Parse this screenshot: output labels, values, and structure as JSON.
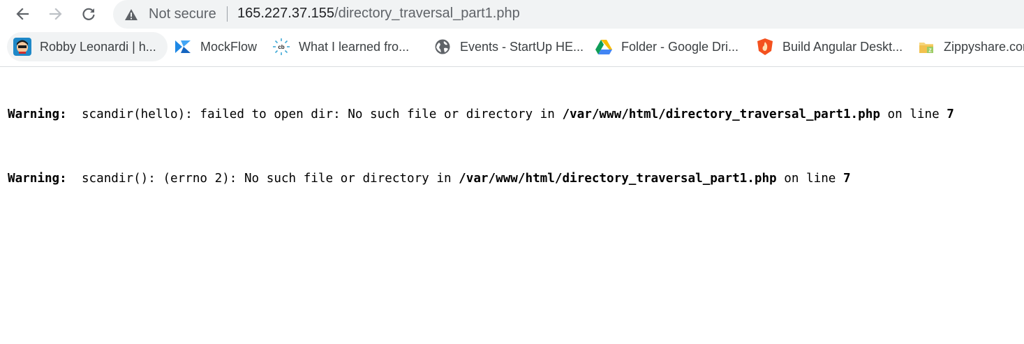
{
  "nav": {
    "back_icon": "back-arrow-icon",
    "forward_icon": "forward-arrow-icon",
    "reload_icon": "reload-icon"
  },
  "address_bar": {
    "security_icon": "warning-triangle-icon",
    "security_label": "Not secure",
    "host": "165.227.37.155",
    "path": "/directory_traversal_part1.php"
  },
  "bookmarks": [
    {
      "label": "Robby Leonardi | h...",
      "icon": "avatar-icon"
    },
    {
      "label": "MockFlow",
      "icon": "mockflow-icon"
    },
    {
      "label": "What I learned fro...",
      "icon": "cb-icon"
    },
    {
      "label": "Events - StartUp HE...",
      "icon": "globe-icon"
    },
    {
      "label": "Folder - Google Dri...",
      "icon": "google-drive-icon"
    },
    {
      "label": "Build Angular Deskt...",
      "icon": "shield-icon"
    },
    {
      "label": "Zippyshare.com",
      "icon": "folder-icon"
    }
  ],
  "content": {
    "warnings": [
      {
        "label": "Warning",
        "message": "scandir(hello): failed to open dir: No such file or directory in",
        "file": "/var/www/html/directory_traversal_part1.php",
        "line_prefix": "on line",
        "line": "7"
      },
      {
        "label": "Warning",
        "message": "scandir(): (errno 2): No such file or directory in",
        "file": "/var/www/html/directory_traversal_part1.php",
        "line_prefix": "on line",
        "line": "7"
      }
    ]
  },
  "colors": {
    "omnibox_bg": "#f1f3f4",
    "icon_gray": "#5f6368",
    "text": "#202124"
  }
}
